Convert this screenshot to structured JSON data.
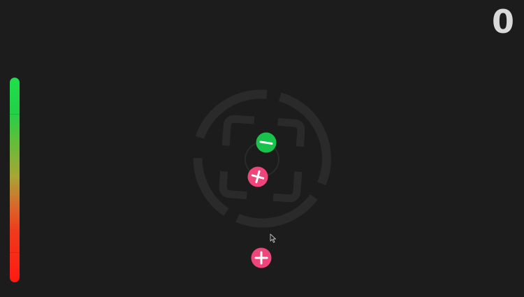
{
  "hud": {
    "score": "0",
    "energy_fraction": 1.0,
    "energy_colors": {
      "top": "#1fe04a",
      "bottom": "#ff1a12"
    }
  },
  "playfield": {
    "ring_color": "#2a2a2a",
    "tokens": [
      {
        "kind": "minus",
        "color": "#19c24a",
        "symbol_color": "#ffffff",
        "icon": "minus-icon"
      },
      {
        "kind": "plus",
        "color": "#f0457a",
        "symbol_color": "#ffffff",
        "icon": "plus-icon"
      },
      {
        "kind": "plus",
        "color": "#f0457a",
        "symbol_color": "#ffffff",
        "icon": "plus-icon"
      }
    ]
  }
}
